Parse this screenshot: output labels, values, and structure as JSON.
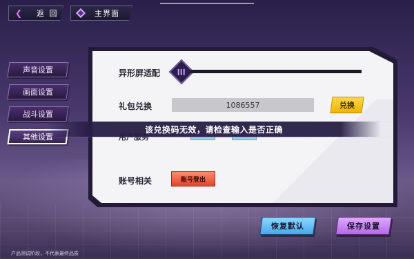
{
  "top_bar": {
    "back_label": "返 回",
    "home_label": "主界面"
  },
  "sidebar": {
    "items": [
      {
        "label": "声音设置",
        "active": false
      },
      {
        "label": "画面设置",
        "active": false
      },
      {
        "label": "战斗设置",
        "active": false
      },
      {
        "label": "其他设置",
        "active": true
      }
    ]
  },
  "panel": {
    "notch_adapt_label": "异形屏适配",
    "notch_adapt_level": 0,
    "gift_label": "礼包兑换",
    "gift_code_value": "1086557",
    "redeem_label": "兑换",
    "user_service_label": "用户服务",
    "account_label": "账号相关",
    "logout_label": "账号登出"
  },
  "toast": {
    "message": "该兑换码无效，请检查输入是否正确"
  },
  "actions": {
    "restore_label": "恢复默认",
    "save_label": "保存设置"
  },
  "footer": {
    "note": "产品测试阶段，不代表最终品质"
  },
  "colors": {
    "accent_purple": "#b46ae6",
    "accent_blue": "#4aa8e8",
    "accent_yellow": "#f0b400",
    "accent_red": "#e2452e"
  }
}
